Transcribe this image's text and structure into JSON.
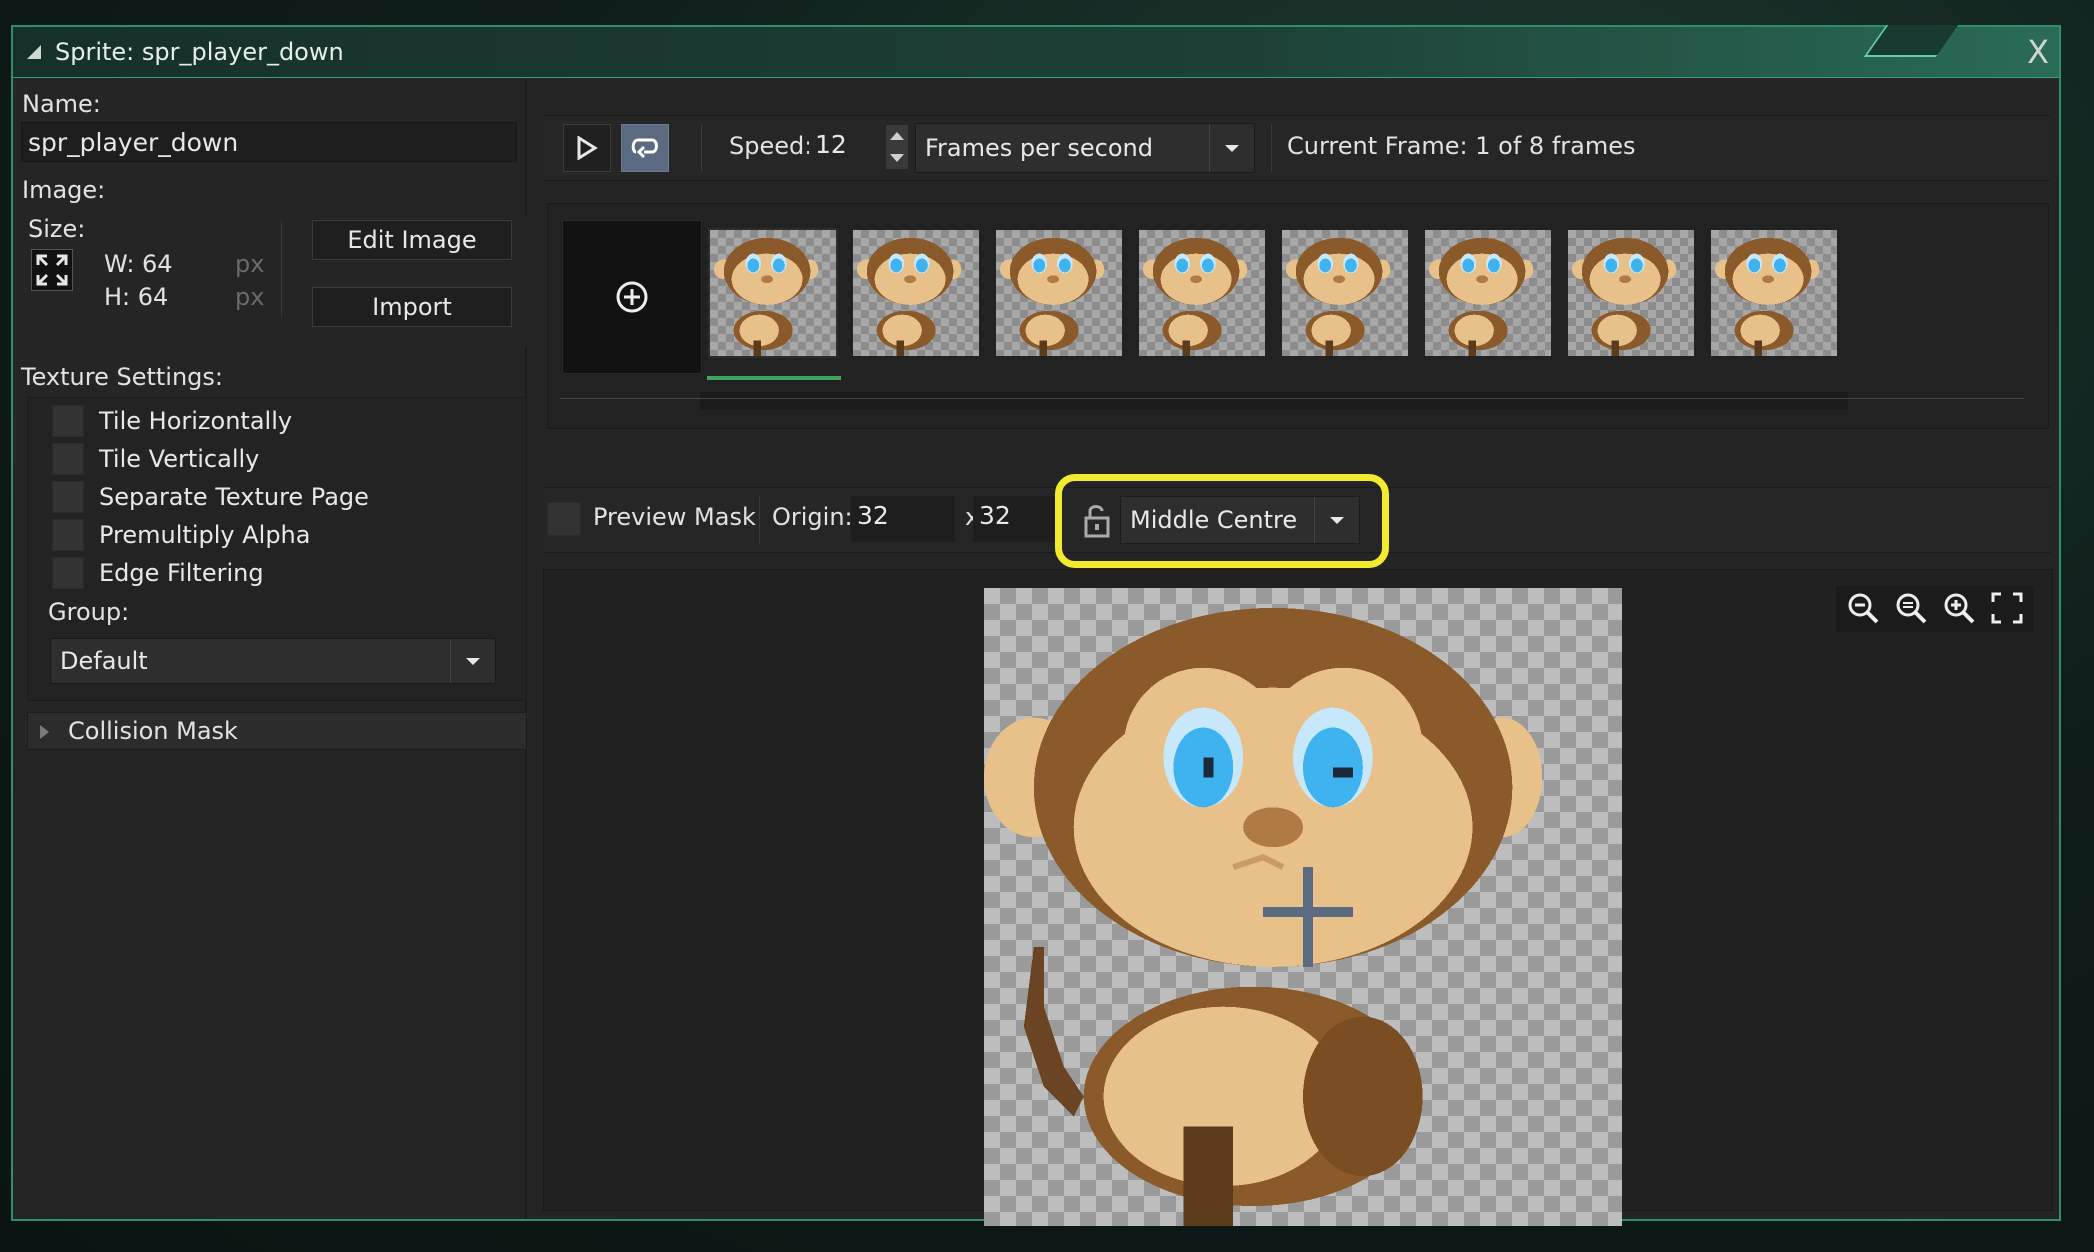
{
  "window": {
    "title": "Sprite: spr_player_down",
    "close_label": "X"
  },
  "left": {
    "name_label": "Name:",
    "name_value": "spr_player_down",
    "image_label": "Image:",
    "size_label": "Size:",
    "width_label": "W: 64",
    "height_label": "H: 64",
    "unit_px": "px",
    "edit_image_label": "Edit Image",
    "import_label": "Import",
    "texture_settings_label": "Texture Settings:",
    "checkboxes": [
      {
        "label": "Tile Horizontally",
        "checked": false
      },
      {
        "label": "Tile Vertically",
        "checked": false
      },
      {
        "label": "Separate Texture Page",
        "checked": false
      },
      {
        "label": "Premultiply Alpha",
        "checked": false
      },
      {
        "label": "Edge Filtering",
        "checked": false
      }
    ],
    "group_label": "Group:",
    "group_value": "Default",
    "collision_mask_label": "Collision Mask"
  },
  "toolbar": {
    "speed_label": "Speed:",
    "speed_value": "12",
    "speed_unit": "Frames per second",
    "current_frame": "Current Frame: 1 of 8 frames"
  },
  "frames": {
    "count": 8,
    "selected_index": 0
  },
  "origin": {
    "preview_mask_label": "Preview Mask",
    "origin_label": "Origin:",
    "origin_x": "32",
    "x_separator": "x",
    "origin_y": "32",
    "preset": "Middle Centre",
    "highlight_color": "#f2ea2e"
  },
  "colors": {
    "accent": "#2f8f6d",
    "frame_indicator": "#3fa55f",
    "monkey_fur": "#8a5a2b",
    "monkey_face": "#e8c08a",
    "eye": "#3fb2f0"
  }
}
